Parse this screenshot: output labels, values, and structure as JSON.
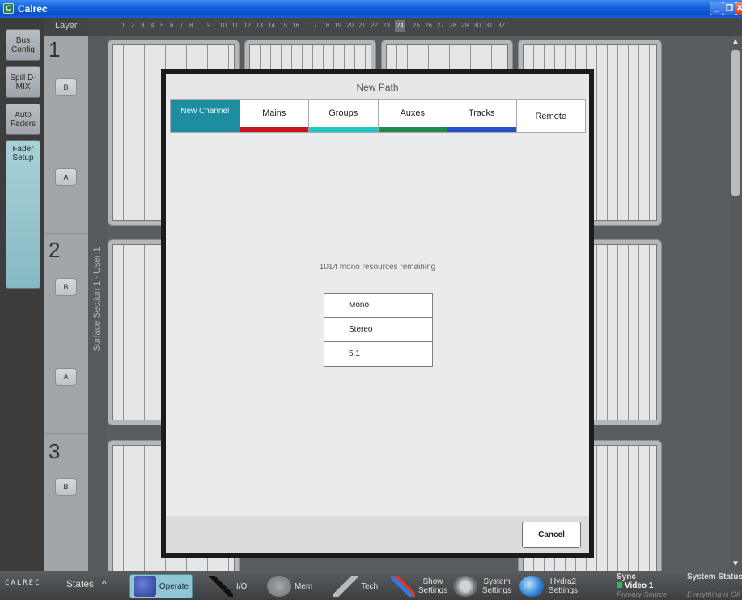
{
  "window": {
    "title": "Calrec",
    "app_icon": "C",
    "minimize": "_",
    "restore": "❐",
    "close": "✕"
  },
  "sidebar": {
    "items": [
      {
        "label": "Bus Config"
      },
      {
        "label": "Spill D-MIX"
      },
      {
        "label": "Auto Faders"
      },
      {
        "label": "Fader Setup",
        "active": true
      }
    ]
  },
  "layer": {
    "header": "Layer",
    "sections": [
      {
        "number": "1",
        "buttons": [
          "B",
          "A"
        ]
      },
      {
        "number": "2",
        "buttons": [
          "B",
          "A"
        ]
      },
      {
        "number": "3",
        "buttons": [
          "B"
        ]
      }
    ]
  },
  "section_label": "Surface Section 1 - User 1",
  "fader_numbers": [
    "1",
    "2",
    "3",
    "4",
    "5",
    "6",
    "7",
    "8",
    "9",
    "10",
    "11",
    "12",
    "13",
    "14",
    "15",
    "16",
    "17",
    "18",
    "19",
    "20",
    "21",
    "22",
    "23",
    "24",
    "25",
    "26",
    "27",
    "28",
    "29",
    "30",
    "31",
    "32"
  ],
  "highlighted_fader": "24",
  "modal": {
    "title": "New Path",
    "tabs": [
      {
        "label": "New Channel",
        "active": true,
        "color": ""
      },
      {
        "label": "Mains",
        "color": "#c8141e"
      },
      {
        "label": "Groups",
        "color": "#1fc7c2"
      },
      {
        "label": "Auxes",
        "color": "#1f8a4c"
      },
      {
        "label": "Tracks",
        "color": "#2851c9"
      },
      {
        "label": "Remote",
        "color": ""
      }
    ],
    "resources_text": "1014 mono resources remaining",
    "formats": [
      "Mono",
      "Stereo",
      "5.1"
    ],
    "cancel_label": "Cancel"
  },
  "bottom_bar": {
    "logo": "CALREC",
    "states_label": "States",
    "items": [
      {
        "label": "Operate",
        "icon": "people-icon",
        "active": true
      },
      {
        "label": "I/O",
        "icon": "microphone-icon"
      },
      {
        "label": "Mem",
        "icon": "memory-stack-icon"
      },
      {
        "label": "Tech",
        "icon": "wrench-icon"
      },
      {
        "label": "Show Settings",
        "icon": "tools-icon"
      },
      {
        "label": "System Settings",
        "icon": "magnifier-icon"
      },
      {
        "label": "Hydra2 Settings",
        "icon": "globe-icon"
      }
    ],
    "sync": {
      "title": "Sync",
      "value": "Video 1",
      "sub": "Primary Source"
    },
    "status": {
      "title": "System Status",
      "sub": "Everything is OK"
    }
  }
}
